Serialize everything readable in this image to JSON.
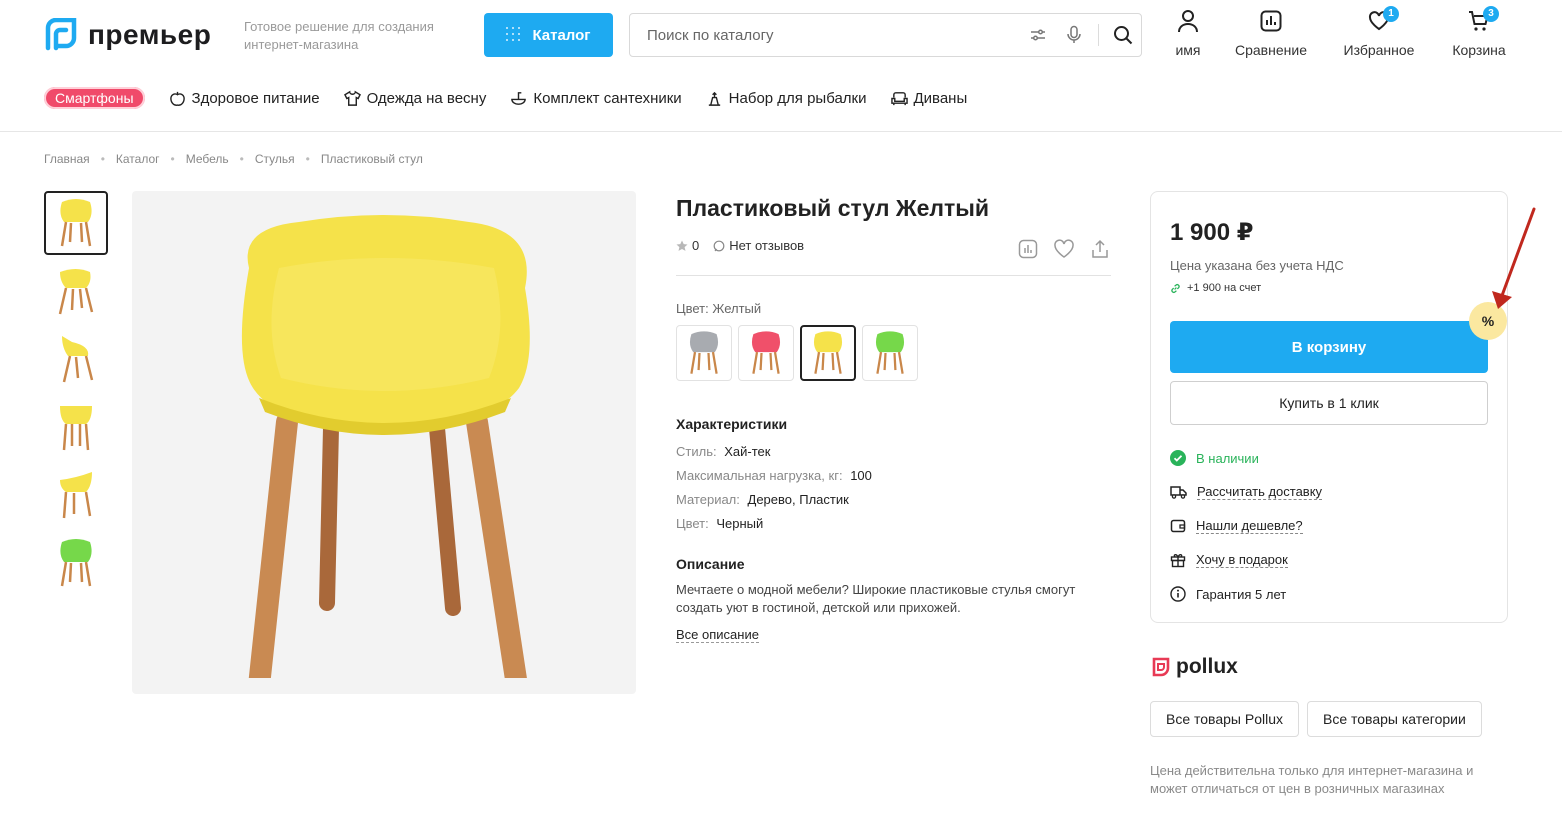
{
  "header": {
    "logo_text": "премьер",
    "tagline": "Готовое решение для создания интернет-магазина",
    "catalog_label": "Каталог",
    "search_placeholder": "Поиск по каталогу",
    "actions": [
      {
        "label": "имя",
        "icon": "user-icon"
      },
      {
        "label": "Сравнение",
        "icon": "compare-icon"
      },
      {
        "label": "Избранное",
        "icon": "heart-icon",
        "badge": "1"
      },
      {
        "label": "Корзина",
        "icon": "cart-icon",
        "badge": "3"
      }
    ]
  },
  "nav": {
    "highlight": "Смартфоны",
    "items": [
      {
        "label": "Здоровое питание",
        "icon": "apple-icon"
      },
      {
        "label": "Одежда на весну",
        "icon": "tshirt-icon"
      },
      {
        "label": "Комплект сантехники",
        "icon": "sink-icon"
      },
      {
        "label": "Набор для рыбалки",
        "icon": "fishing-icon"
      },
      {
        "label": "Диваны",
        "icon": "sofa-icon"
      }
    ]
  },
  "breadcrumb": [
    "Главная",
    "Каталог",
    "Мебель",
    "Стулья",
    "Пластиковый стул"
  ],
  "product": {
    "title": "Пластиковый стул Желтый",
    "rating": "0",
    "reviews": "Нет отзывов",
    "color_label": "Цвет: Желтый",
    "swatch_colors": [
      "#a8abb0",
      "#f0506a",
      "#f5e24a",
      "#76d84a"
    ],
    "thumb_colors": [
      "#f5e24a",
      "#f5e24a",
      "#f5e24a",
      "#f5e24a",
      "#f5e24a",
      "#76d84a"
    ],
    "specs_title": "Характеристики",
    "specs": [
      {
        "k": "Стиль:",
        "v": "Хай-тек"
      },
      {
        "k": "Максимальная нагрузка, кг:",
        "v": "100"
      },
      {
        "k": "Материал:",
        "v": "Дерево, Пластик"
      },
      {
        "k": "Цвет:",
        "v": "Черный"
      }
    ],
    "desc_title": "Описание",
    "desc": "Мечтаете о модной мебели? Широкие пластиковые стулья смогут создать уют в гостиной, детской или прихожей.",
    "desc_link": "Все описание"
  },
  "buybox": {
    "price": "1 900 ₽",
    "price_note": "Цена указана без учета НДС",
    "cashback": "+1 900 на счет",
    "cart_label": "В корзину",
    "oneclick_label": "Купить в 1 клик",
    "promo_symbol": "%",
    "stock": "В наличии",
    "delivery": "Рассчитать доставку",
    "cheaper": "Нашли дешевле?",
    "gift": "Хочу в подарок",
    "warranty": "Гарантия 5 лет"
  },
  "brand": {
    "name": "pollux",
    "btn_all_brand": "Все товары Pollux",
    "btn_all_category": "Все товары категории",
    "disclaimer": "Цена действительна только для интернет-магазина и может отличаться от цен в розничных магазинах"
  },
  "colors": {
    "accent": "#1eaaf1",
    "pink": "#f04a6a",
    "green": "#29b35a",
    "arrow": "#c0281e"
  }
}
